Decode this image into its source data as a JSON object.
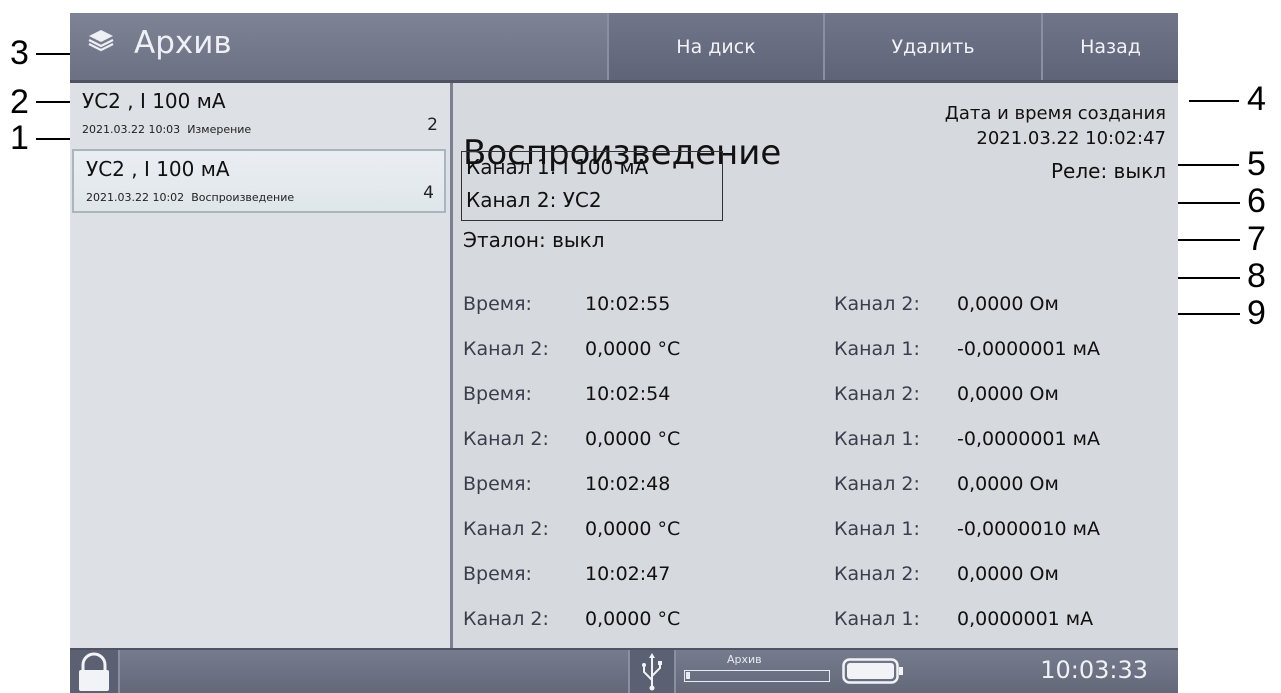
{
  "header": {
    "title": "Архив",
    "buttons": [
      "На диск",
      "Удалить",
      "Назад"
    ]
  },
  "archive_list": [
    {
      "title": "УС2 , I 100 мА",
      "timestamp": "2021.03.22 10:03",
      "mode": "Измерение",
      "count": "2",
      "selected": false
    },
    {
      "title": "УС2 , I 100 мА",
      "timestamp": "2021.03.22 10:02",
      "mode": "Воспроизведение",
      "count": "4",
      "selected": true
    }
  ],
  "record": {
    "mode_title": "Воспроизведение",
    "created_label": "Дата и время создания",
    "created_value": "2021.03.22 10:02:47",
    "relay": "Реле: выкл",
    "channel1": "Канал 1: I 100 мА",
    "channel2": "Канал 2: УС2",
    "etalon": "Эталон: выкл"
  },
  "measurements": [
    {
      "l1": "Время:",
      "v1": "10:02:55",
      "l2": "Канал 2:",
      "v2": "0,0000 Ом"
    },
    {
      "l1": "Канал 2:",
      "v1": "0,0000 °C",
      "l2": "Канал 1:",
      "v2": "-0,0000001 мА"
    },
    {
      "l1": "Время:",
      "v1": "10:02:54",
      "l2": "Канал 2:",
      "v2": "0,0000 Ом"
    },
    {
      "l1": "Канал 2:",
      "v1": "0,0000 °C",
      "l2": "Канал 1:",
      "v2": "-0,0000001 мА"
    },
    {
      "l1": "Время:",
      "v1": "10:02:48",
      "l2": "Канал 2:",
      "v2": "0,0000 Ом"
    },
    {
      "l1": "Канал 2:",
      "v1": "0,0000 °C",
      "l2": "Канал 1:",
      "v2": "-0,0000010 мА"
    },
    {
      "l1": "Время:",
      "v1": "10:02:47",
      "l2": "Канал 2:",
      "v2": "0,0000 Ом"
    },
    {
      "l1": "Канал 2:",
      "v1": "0,0000 °C",
      "l2": "Канал 1:",
      "v2": "0,0000001 мА"
    }
  ],
  "statusbar": {
    "archive_label": "Архив",
    "archive_fill_fraction": 0.03,
    "clock": "10:03:33",
    "icons": [
      "lock-icon",
      "usb-icon",
      "battery-icon"
    ]
  },
  "callouts": [
    "1",
    "2",
    "3",
    "4",
    "5",
    "6",
    "7",
    "8",
    "9"
  ]
}
